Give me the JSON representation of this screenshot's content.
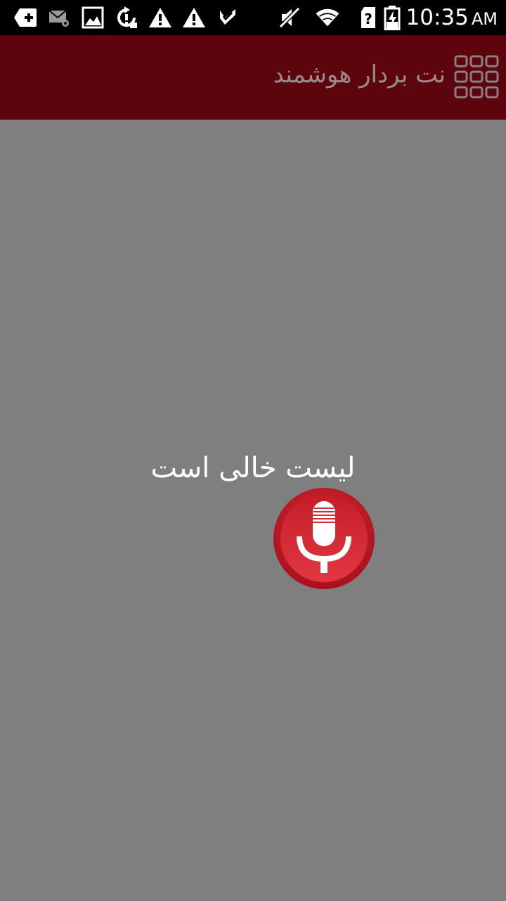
{
  "status_bar": {
    "left_icons": [
      "add-notification-icon",
      "email-settings-icon",
      "gallery-icon",
      "sync-alert-icon",
      "warning-icon",
      "warning-icon",
      "check-download-icon"
    ],
    "right_icons": [
      "mute-icon",
      "wifi-icon",
      "sim-unknown-icon",
      "battery-charging-icon"
    ],
    "time": "10:35",
    "ampm": "AM"
  },
  "app_bar": {
    "title": "نت بردار هوشمند",
    "menu_icon": "grid-menu-icon",
    "background": "#5c050c",
    "title_color": "#9a8a8c"
  },
  "main": {
    "empty_message": "لیست خالی است",
    "record_button_icon": "microphone-icon",
    "accent_color": "#d32b36"
  }
}
